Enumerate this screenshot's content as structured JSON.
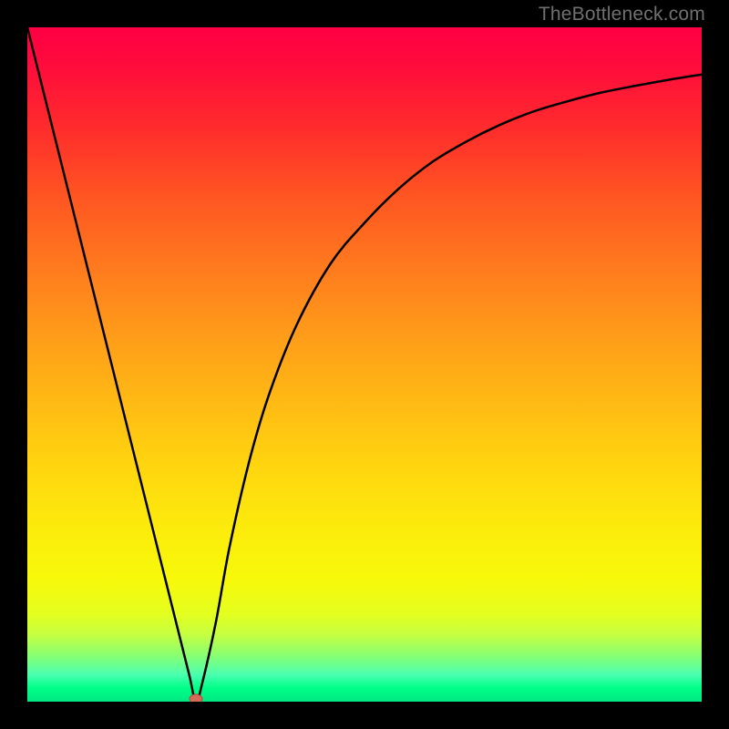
{
  "attribution": "TheBottleneck.com",
  "chart_data": {
    "type": "line",
    "title": "",
    "xlabel": "",
    "ylabel": "",
    "xlim": [
      0,
      100
    ],
    "ylim": [
      0,
      100
    ],
    "grid": false,
    "legend": "none",
    "background": "rainbow-gradient (red top → green bottom)",
    "series": [
      {
        "name": "bottleneck-curve",
        "x": [
          0,
          5,
          10,
          15,
          20,
          22,
          24,
          25,
          26,
          28,
          30,
          33,
          36,
          40,
          45,
          50,
          55,
          60,
          65,
          70,
          75,
          80,
          85,
          90,
          95,
          100
        ],
        "values": [
          100,
          80,
          60,
          40,
          20,
          12,
          4,
          0,
          3,
          12,
          23,
          36,
          46,
          56,
          65,
          71,
          76,
          80,
          83,
          85.5,
          87.5,
          89,
          90.3,
          91.3,
          92.2,
          93
        ]
      }
    ],
    "marker": {
      "x": 25,
      "y": 0,
      "color": "#d46a5a",
      "shape": "ellipse"
    }
  }
}
